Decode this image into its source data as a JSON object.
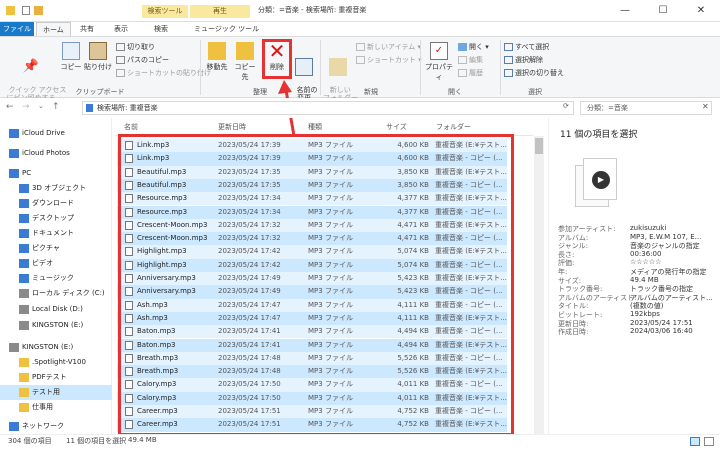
{
  "title_bar": {
    "context_tab_search": "検索ツール",
    "context_tab_play": "再生",
    "window_title": "分類：=音楽 - 検索場所: 重複音楽"
  },
  "ribbon_tabs": [
    "ファイル",
    "ホーム",
    "共有",
    "表示",
    "検索",
    "ミュージック ツール"
  ],
  "ribbon": {
    "clipboard": {
      "quick_access": "クイック アクセス\nにピン留めする",
      "copy": "コピー",
      "paste": "貼り付け",
      "cut": "切り取り",
      "copy_path": "パスのコピー",
      "paste_shortcut": "ショートカットの貼り付け",
      "group": "クリップボード"
    },
    "organize": {
      "move_to": "移動先",
      "copy_to": "コピー先",
      "delete": "削除",
      "rename": "名前の\n変更",
      "group": "整理"
    },
    "new": {
      "new_folder": "新しい\nフォルダー",
      "new_item": "新しいアイテム ▾",
      "shortcut": "ショートカット ▾",
      "group": "新規"
    },
    "open": {
      "properties": "プロパティ",
      "open_btn": "開く ▾",
      "edit": "編集",
      "history": "履歴",
      "group": "開く"
    },
    "select": {
      "select_all": "すべて選択",
      "select_none": "選択解除",
      "invert": "選択の切り替え",
      "group": "選択"
    }
  },
  "address": {
    "path": "検索場所: 重複音楽",
    "search": "分類：=音楽"
  },
  "sidebar": [
    {
      "label": "iCloud Drive",
      "icon": "cloud-icon"
    },
    {
      "label": "iCloud Photos",
      "icon": "photos-icon"
    },
    {
      "label": "PC",
      "icon": "pc-icon"
    },
    {
      "label": "3D オブジェクト",
      "icon": "3d-objects-icon"
    },
    {
      "label": "ダウンロード",
      "icon": "download-icon"
    },
    {
      "label": "デスクトップ",
      "icon": "desktop-icon"
    },
    {
      "label": "ドキュメント",
      "icon": "documents-icon"
    },
    {
      "label": "ピクチャ",
      "icon": "pictures-icon"
    },
    {
      "label": "ビデオ",
      "icon": "video-icon"
    },
    {
      "label": "ミュージック",
      "icon": "music-icon"
    },
    {
      "label": "ローカル ディスク (C:)",
      "icon": "disk-icon"
    },
    {
      "label": "Local Disk (D:)",
      "icon": "disk-icon"
    },
    {
      "label": "KINGSTON (E:)",
      "icon": "usb-drive-icon"
    },
    {
      "label": "KINGSTON (E:)",
      "icon": "usb-drive-icon"
    },
    {
      "label": ".Spotlight-V100",
      "icon": "folder-icon"
    },
    {
      "label": "PDFテスト",
      "icon": "folder-icon"
    },
    {
      "label": "テスト用",
      "icon": "folder-icon"
    },
    {
      "label": "仕事用",
      "icon": "folder-icon"
    },
    {
      "label": "ネットワーク",
      "icon": "network-icon"
    }
  ],
  "columns": {
    "name": "名前",
    "date": "更新日時",
    "type": "種類",
    "size": "サイズ",
    "folder": "フォルダー"
  },
  "files": [
    {
      "name": "Link.mp3",
      "date": "2023/05/24 17:39",
      "type": "MP3 ファイル",
      "size": "4,600 KB",
      "folder": "重複音楽 (E:¥テスト..."
    },
    {
      "name": "Link.mp3",
      "date": "2023/05/24 17:39",
      "type": "MP3 ファイル",
      "size": "4,600 KB",
      "folder": "重複音楽 - コピー (..."
    },
    {
      "name": "Beautiful.mp3",
      "date": "2023/05/24 17:35",
      "type": "MP3 ファイル",
      "size": "3,850 KB",
      "folder": "重複音楽 (E:¥テスト..."
    },
    {
      "name": "Beautiful.mp3",
      "date": "2023/05/24 17:35",
      "type": "MP3 ファイル",
      "size": "3,850 KB",
      "folder": "重複音楽 - コピー (..."
    },
    {
      "name": "Resource.mp3",
      "date": "2023/05/24 17:34",
      "type": "MP3 ファイル",
      "size": "4,377 KB",
      "folder": "重複音楽 (E:¥テスト..."
    },
    {
      "name": "Resource.mp3",
      "date": "2023/05/24 17:34",
      "type": "MP3 ファイル",
      "size": "4,377 KB",
      "folder": "重複音楽 - コピー (..."
    },
    {
      "name": "Crescent-Moon.mp3",
      "date": "2023/05/24 17:32",
      "type": "MP3 ファイル",
      "size": "4,471 KB",
      "folder": "重複音楽 (E:¥テスト..."
    },
    {
      "name": "Crescent-Moon.mp3",
      "date": "2023/05/24 17:32",
      "type": "MP3 ファイル",
      "size": "4,471 KB",
      "folder": "重複音楽 - コピー (..."
    },
    {
      "name": "Highlight.mp3",
      "date": "2023/05/24 17:42",
      "type": "MP3 ファイル",
      "size": "5,074 KB",
      "folder": "重複音楽 (E:¥テスト..."
    },
    {
      "name": "Highlight.mp3",
      "date": "2023/05/24 17:42",
      "type": "MP3 ファイル",
      "size": "5,074 KB",
      "folder": "重複音楽 - コピー (..."
    },
    {
      "name": "Anniversary.mp3",
      "date": "2023/05/24 17:49",
      "type": "MP3 ファイル",
      "size": "5,423 KB",
      "folder": "重複音楽 (E:¥テスト..."
    },
    {
      "name": "Anniversary.mp3",
      "date": "2023/05/24 17:49",
      "type": "MP3 ファイル",
      "size": "5,423 KB",
      "folder": "重複音楽 - コピー (..."
    },
    {
      "name": "Ash.mp3",
      "date": "2023/05/24 17:47",
      "type": "MP3 ファイル",
      "size": "4,111 KB",
      "folder": "重複音楽 - コピー (..."
    },
    {
      "name": "Ash.mp3",
      "date": "2023/05/24 17:47",
      "type": "MP3 ファイル",
      "size": "4,111 KB",
      "folder": "重複音楽 (E:¥テスト..."
    },
    {
      "name": "Baton.mp3",
      "date": "2023/05/24 17:41",
      "type": "MP3 ファイル",
      "size": "4,494 KB",
      "folder": "重複音楽 - コピー (..."
    },
    {
      "name": "Baton.mp3",
      "date": "2023/05/24 17:41",
      "type": "MP3 ファイル",
      "size": "4,494 KB",
      "folder": "重複音楽 (E:¥テスト..."
    },
    {
      "name": "Breath.mp3",
      "date": "2023/05/24 17:48",
      "type": "MP3 ファイル",
      "size": "5,526 KB",
      "folder": "重複音楽 - コピー (..."
    },
    {
      "name": "Breath.mp3",
      "date": "2023/05/24 17:48",
      "type": "MP3 ファイル",
      "size": "5,526 KB",
      "folder": "重複音楽 (E:¥テスト..."
    },
    {
      "name": "Calory.mp3",
      "date": "2023/05/24 17:50",
      "type": "MP3 ファイル",
      "size": "4,011 KB",
      "folder": "重複音楽 - コピー (..."
    },
    {
      "name": "Calory.mp3",
      "date": "2023/05/24 17:50",
      "type": "MP3 ファイル",
      "size": "4,011 KB",
      "folder": "重複音楽 (E:¥テスト..."
    },
    {
      "name": "Career.mp3",
      "date": "2023/05/24 17:51",
      "type": "MP3 ファイル",
      "size": "4,752 KB",
      "folder": "重複音楽 - コピー (..."
    },
    {
      "name": "Career.mp3",
      "date": "2023/05/24 17:51",
      "type": "MP3 ファイル",
      "size": "4,752 KB",
      "folder": "重複音楽 (E:¥テスト..."
    }
  ],
  "details": {
    "heading": "11 個の項目を選択",
    "props": [
      {
        "k": "参加アーティスト:",
        "v": "zukisuzuki"
      },
      {
        "k": "アルバム:",
        "v": "MP3, E.W.M 107, E..."
      },
      {
        "k": "ジャンル:",
        "v": "音楽のジャンルの指定"
      },
      {
        "k": "長さ:",
        "v": "00:36:00"
      },
      {
        "k": "評価:",
        "v": "☆☆☆☆☆"
      },
      {
        "k": "年:",
        "v": "メディアの発行年の指定"
      },
      {
        "k": "サイズ:",
        "v": "49.4 MB"
      },
      {
        "k": "トラック番号:",
        "v": "トラック番号の指定"
      },
      {
        "k": "アルバムのアーティスト:",
        "v": "アルバムのアーティスト..."
      },
      {
        "k": "タイトル:",
        "v": "(複数の値)"
      },
      {
        "k": "ビットレート:",
        "v": "192kbps"
      },
      {
        "k": "更新日時:",
        "v": "2023/05/24 17:51"
      },
      {
        "k": "作成日時:",
        "v": "2024/03/06 16:40"
      }
    ]
  },
  "status": {
    "count": "304 個の項目",
    "selected": "11 個の項目を選択",
    "size": "49.4 MB"
  },
  "colors": {
    "accent": "#1979ca",
    "highlight": "#e53333",
    "selection": "#cce8ff"
  }
}
